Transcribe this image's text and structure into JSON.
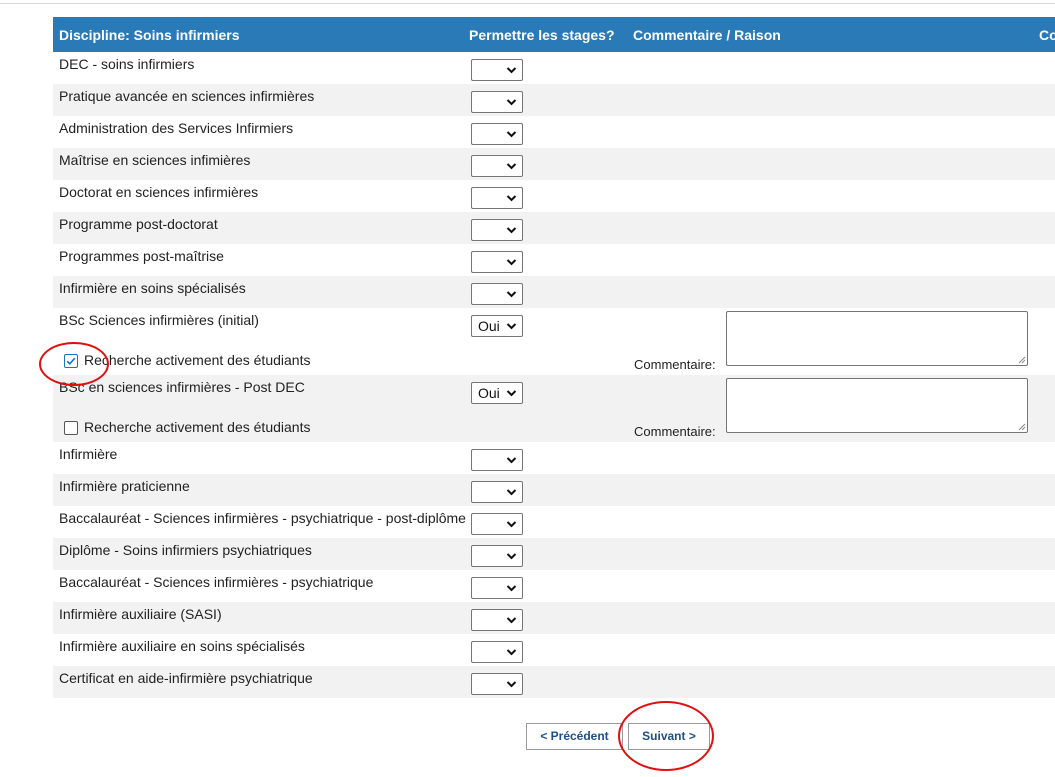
{
  "header": {
    "col_discipline": "Discipline: Soins infirmiers",
    "col_permit": "Permettre les stages?",
    "col_comment": "Commentaire / Raison",
    "col_extra": "Co"
  },
  "rows": [
    {
      "label": "DEC - soins infirmiers",
      "value": ""
    },
    {
      "label": "Pratique avancée en sciences infirmières",
      "value": ""
    },
    {
      "label": "Administration des Services Infirmiers",
      "value": ""
    },
    {
      "label": "Maîtrise en sciences infimières",
      "value": ""
    },
    {
      "label": "Doctorat en sciences infirmières",
      "value": ""
    },
    {
      "label": "Programme post-doctorat",
      "value": ""
    },
    {
      "label": "Programmes post-maîtrise",
      "value": ""
    },
    {
      "label": "Infirmière en soins spécialisés",
      "value": ""
    },
    {
      "label": "BSc Sciences infirmières (initial)",
      "value": "Oui",
      "checkbox_label": "Recherche activement des étudiants",
      "checked": true,
      "comment_label": "Commentaire:",
      "comment_value": ""
    },
    {
      "label": "BSc en sciences infirmières - Post DEC",
      "value": "Oui",
      "checkbox_label": "Recherche activement des étudiants",
      "checked": false,
      "comment_label": "Commentaire:",
      "comment_value": ""
    },
    {
      "label": "Infirmière",
      "value": ""
    },
    {
      "label": "Infirmière praticienne",
      "value": ""
    },
    {
      "label": "Baccalauréat - Sciences infirmières - psychiatrique - post-diplôme",
      "value": ""
    },
    {
      "label": "Diplôme - Soins infirmiers psychiatriques",
      "value": ""
    },
    {
      "label": "Baccalauréat - Sciences infirmières - psychiatrique",
      "value": ""
    },
    {
      "label": "Infirmière auxiliaire (SASI)",
      "value": ""
    },
    {
      "label": "Infirmière auxiliaire en soins spécialisés",
      "value": ""
    },
    {
      "label": "Certificat en aide-infirmière psychiatrique",
      "value": ""
    }
  ],
  "nav": {
    "prev_label": "< Précédent",
    "next_label": "Suivant >"
  },
  "colors": {
    "header_bg": "#2a7ab8",
    "alt_row_bg": "#f2f2f2",
    "annotation_ring": "#e01010"
  },
  "icons": {
    "select_arrow": "chevron-down-icon",
    "checkbox_check": "check-icon"
  }
}
